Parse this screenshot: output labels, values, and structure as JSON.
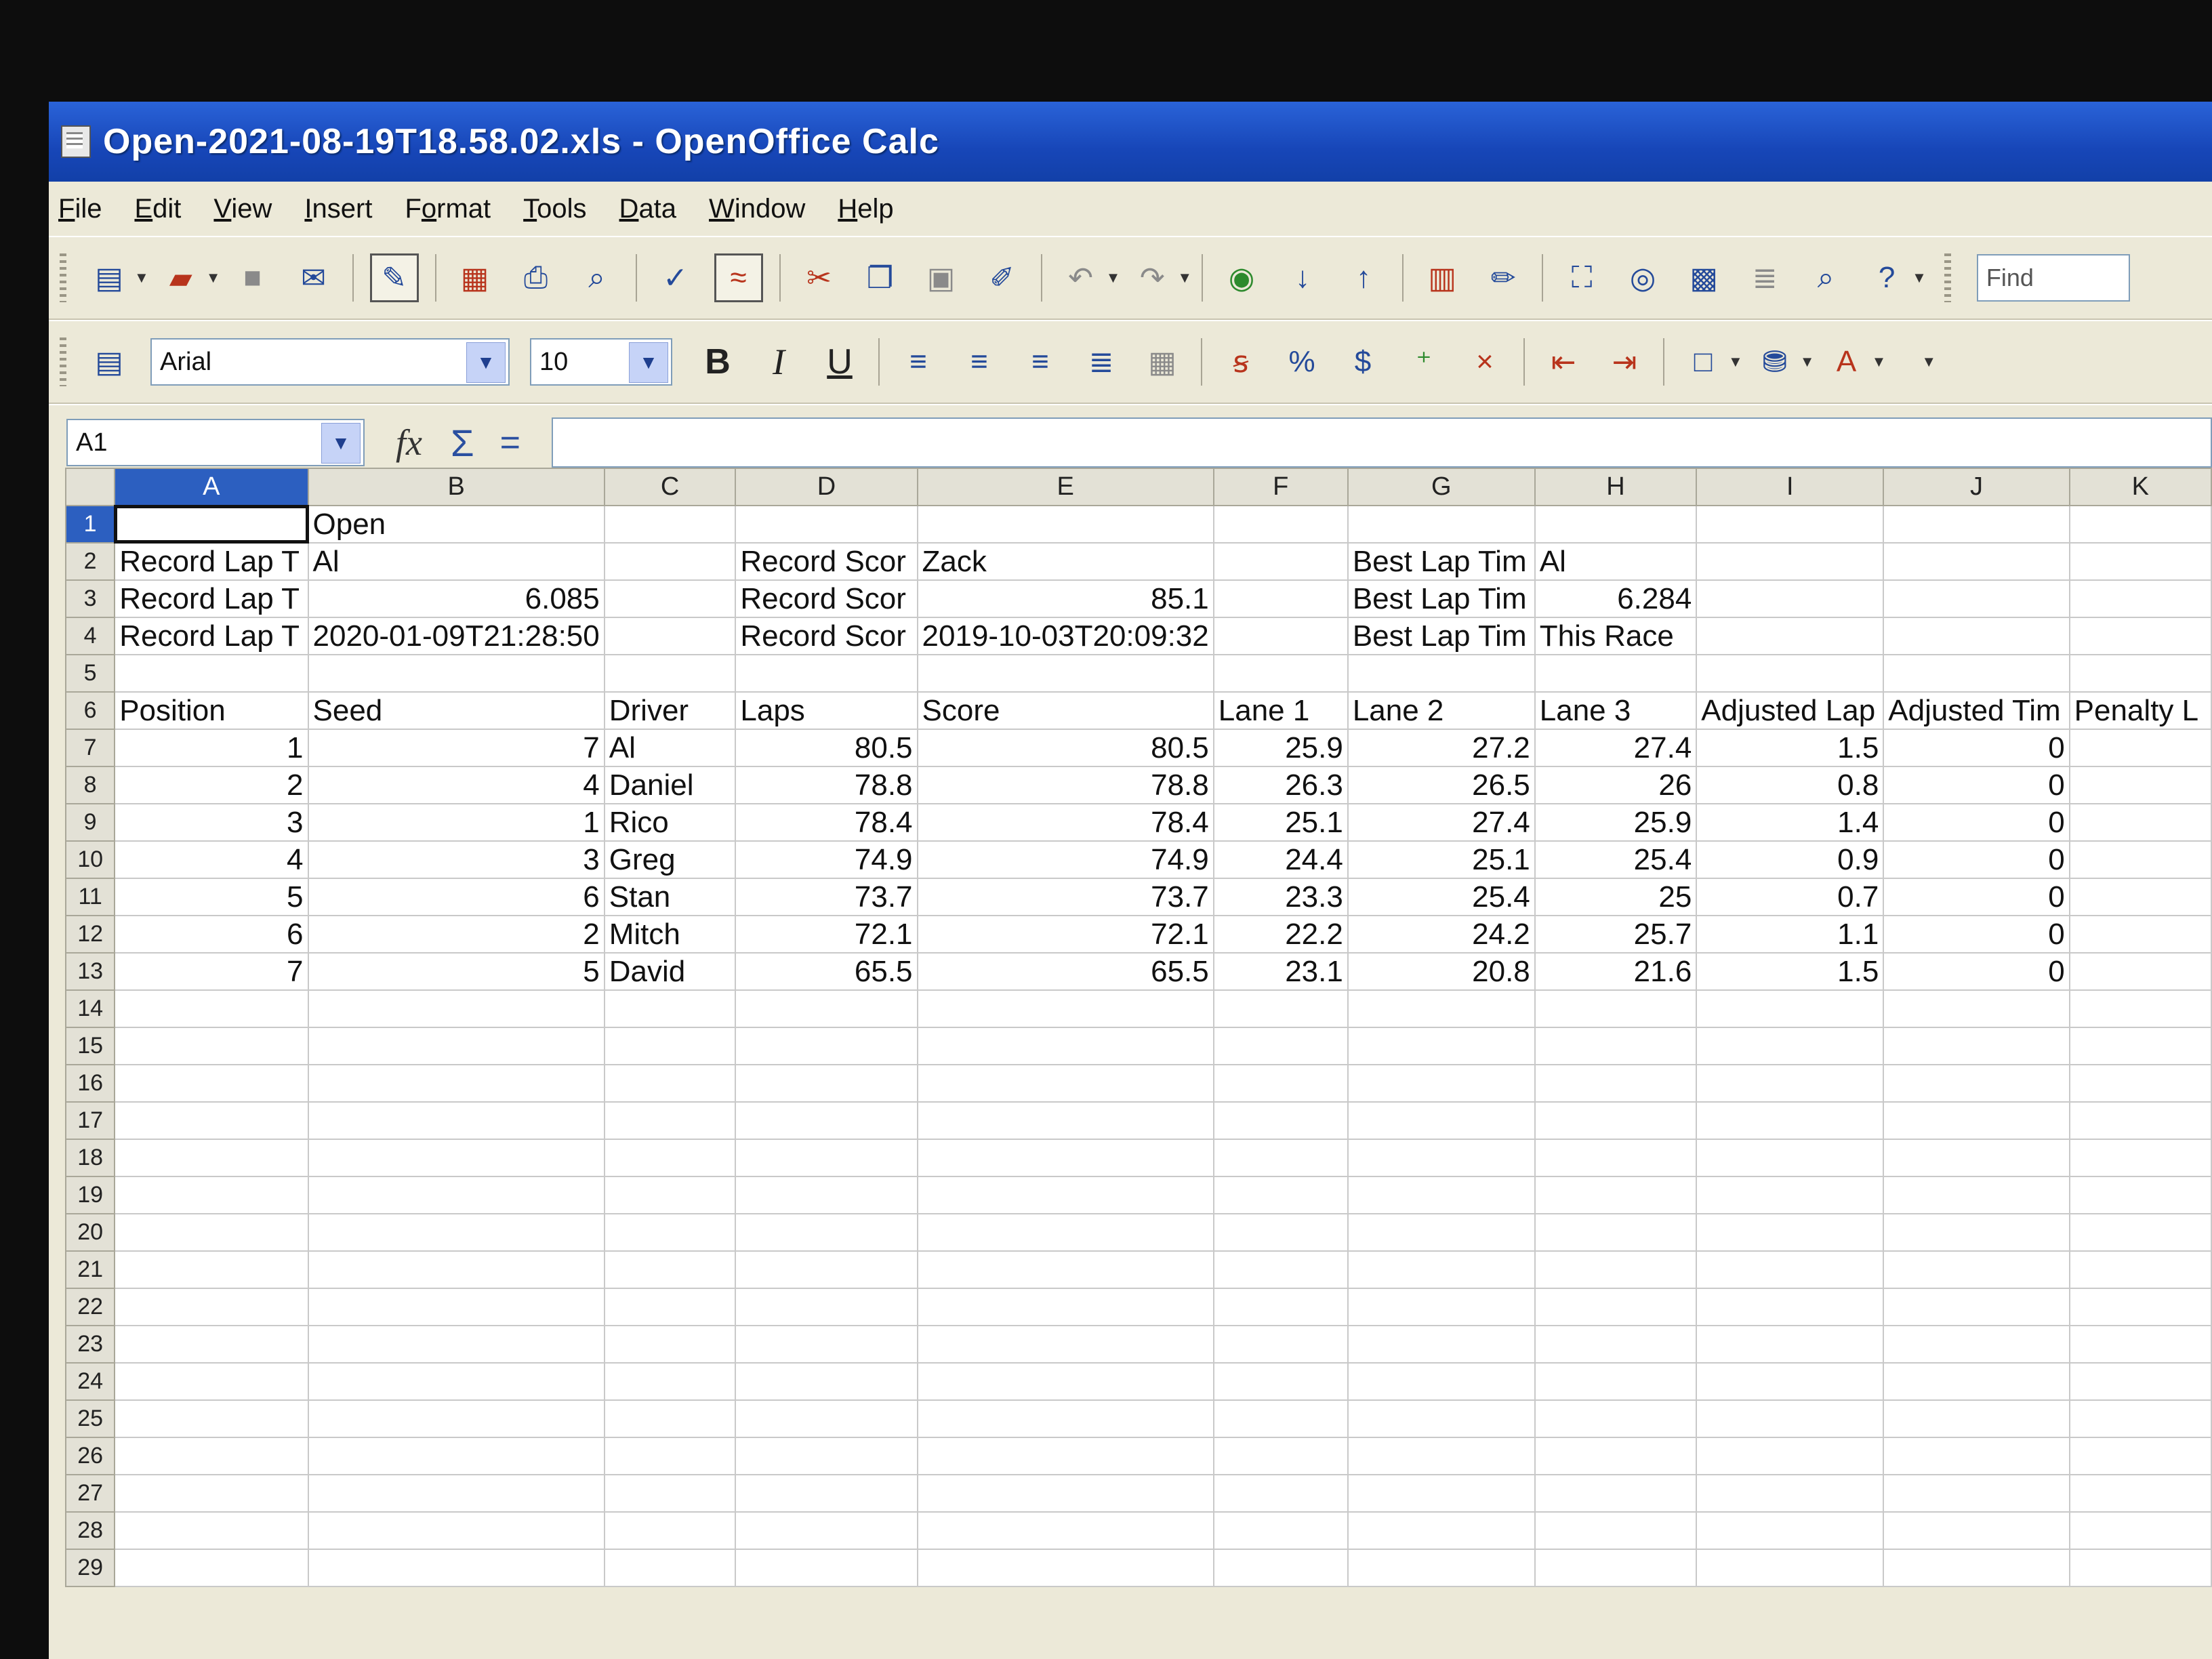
{
  "window": {
    "title": "Open-2021-08-19T18.58.02.xls - OpenOffice Calc"
  },
  "menu": [
    "File",
    "Edit",
    "View",
    "Insert",
    "Format",
    "Tools",
    "Data",
    "Window",
    "Help"
  ],
  "menu_accel": [
    "F",
    "E",
    "V",
    "I",
    "o",
    "T",
    "D",
    "W",
    "H"
  ],
  "toolbar": {
    "find_placeholder": "Find"
  },
  "format": {
    "font": "Arial",
    "size": "10",
    "bold": "B",
    "italic": "I",
    "underline": "U"
  },
  "formula": {
    "cell_ref": "A1",
    "value": ""
  },
  "columns": [
    "A",
    "B",
    "C",
    "D",
    "E",
    "F",
    "G",
    "H",
    "I",
    "J",
    "K"
  ],
  "rows": [
    [
      "",
      "Open",
      "",
      "",
      "",
      "",
      "",
      "",
      "",
      "",
      ""
    ],
    [
      "Record Lap T",
      "Al",
      "",
      "Record Scor",
      "Zack",
      "",
      "Best Lap Tim",
      "Al",
      "",
      "",
      ""
    ],
    [
      "Record Lap T",
      "6.085",
      "",
      "Record Scor",
      "85.1",
      "",
      "Best Lap Tim",
      "6.284",
      "",
      "",
      ""
    ],
    [
      "Record Lap T",
      "2020-01-09T21:28:50",
      "",
      "Record Scor",
      "2019-10-03T20:09:32",
      "",
      "Best Lap Tim",
      "This Race",
      "",
      "",
      ""
    ],
    [
      "",
      "",
      "",
      "",
      "",
      "",
      "",
      "",
      "",
      "",
      ""
    ],
    [
      "Position",
      "Seed",
      "Driver",
      "Laps",
      "Score",
      "Lane 1",
      "Lane 2",
      "Lane 3",
      "Adjusted Lap",
      "Adjusted Tim",
      "Penalty L"
    ],
    [
      "1",
      "7",
      "Al",
      "80.5",
      "80.5",
      "25.9",
      "27.2",
      "27.4",
      "1.5",
      "0",
      ""
    ],
    [
      "2",
      "4",
      "Daniel",
      "78.8",
      "78.8",
      "26.3",
      "26.5",
      "26",
      "0.8",
      "0",
      ""
    ],
    [
      "3",
      "1",
      "Rico",
      "78.4",
      "78.4",
      "25.1",
      "27.4",
      "25.9",
      "1.4",
      "0",
      ""
    ],
    [
      "4",
      "3",
      "Greg",
      "74.9",
      "74.9",
      "24.4",
      "25.1",
      "25.4",
      "0.9",
      "0",
      ""
    ],
    [
      "5",
      "6",
      "Stan",
      "73.7",
      "73.7",
      "23.3",
      "25.4",
      "25",
      "0.7",
      "0",
      ""
    ],
    [
      "6",
      "2",
      "Mitch",
      "72.1",
      "72.1",
      "22.2",
      "24.2",
      "25.7",
      "1.1",
      "0",
      ""
    ],
    [
      "7",
      "5",
      "David",
      "65.5",
      "65.5",
      "23.1",
      "20.8",
      "21.6",
      "1.5",
      "0",
      ""
    ]
  ],
  "row_numbers": [
    "1",
    "2",
    "3",
    "4",
    "5",
    "6",
    "7",
    "8",
    "9",
    "10",
    "11",
    "12",
    "13",
    "14",
    "15",
    "16",
    "17",
    "18",
    "19",
    "20",
    "21",
    "22",
    "23",
    "24",
    "25",
    "26",
    "27",
    "28",
    "29"
  ],
  "colors": {
    "titlebar": "#2a63d8",
    "selection": "#2c5fc0",
    "face": "#ece9d8"
  }
}
